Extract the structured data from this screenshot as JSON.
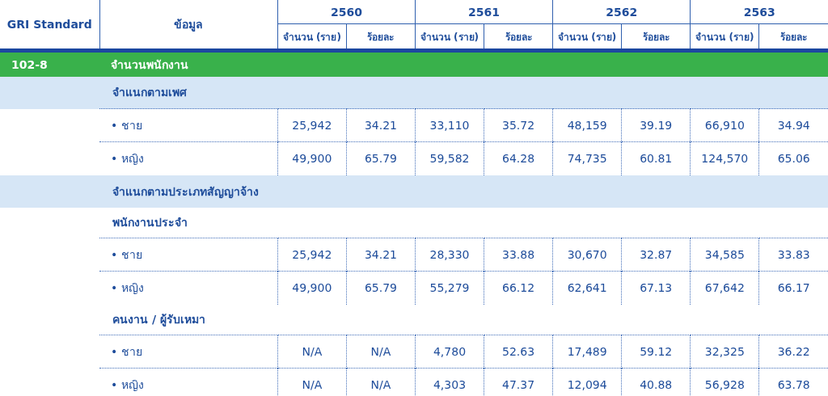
{
  "header": {
    "standard": "GRI Standard",
    "info": "ข้อมูล",
    "years": [
      {
        "year": "2560",
        "subcolumns": [
          "จำนวน (ราย)",
          "ร้อยละ"
        ]
      },
      {
        "year": "2561",
        "subcolumns": [
          "จำนวน (ราย)",
          "ร้อยละ"
        ]
      },
      {
        "year": "2562",
        "subcolumns": [
          "จำนวน (ราย)",
          "ร้อยละ"
        ]
      },
      {
        "year": "2563",
        "subcolumns": [
          "จำนวน (ราย)",
          "ร้อยละ"
        ]
      }
    ]
  },
  "rows": [
    {
      "kind": "section",
      "code": "102-8",
      "label": "จำนวนพนักงาน"
    },
    {
      "kind": "group",
      "label": "จำแนกตามเพศ"
    },
    {
      "kind": "data",
      "label": "• ชาย",
      "values": [
        "25,942",
        "34.21",
        "33,110",
        "35.72",
        "48,159",
        "39.19",
        "66,910",
        "34.94"
      ]
    },
    {
      "kind": "data",
      "label": "• หญิง",
      "values": [
        "49,900",
        "65.79",
        "59,582",
        "64.28",
        "74,735",
        "60.81",
        "124,570",
        "65.06"
      ]
    },
    {
      "kind": "group",
      "label": "จำแนกตามประเภทสัญญาจ้าง"
    },
    {
      "kind": "subgroup",
      "label": "พนักงานประจำ"
    },
    {
      "kind": "data",
      "label": "• ชาย",
      "values": [
        "25,942",
        "34.21",
        "28,330",
        "33.88",
        "30,670",
        "32.87",
        "34,585",
        "33.83"
      ]
    },
    {
      "kind": "data",
      "label": "• หญิง",
      "values": [
        "49,900",
        "65.79",
        "55,279",
        "66.12",
        "62,641",
        "67.13",
        "67,642",
        "66.17"
      ]
    },
    {
      "kind": "subgroup",
      "label": "คนงาน / ผู้รับเหมา"
    },
    {
      "kind": "data",
      "label": "• ชาย",
      "values": [
        "N/A",
        "N/A",
        "4,780",
        "52.63",
        "17,489",
        "59.12",
        "32,325",
        "36.22"
      ]
    },
    {
      "kind": "data",
      "label": "• หญิง",
      "values": [
        "N/A",
        "N/A",
        "4,303",
        "47.37",
        "12,094",
        "40.88",
        "56,928",
        "63.78"
      ]
    }
  ]
}
